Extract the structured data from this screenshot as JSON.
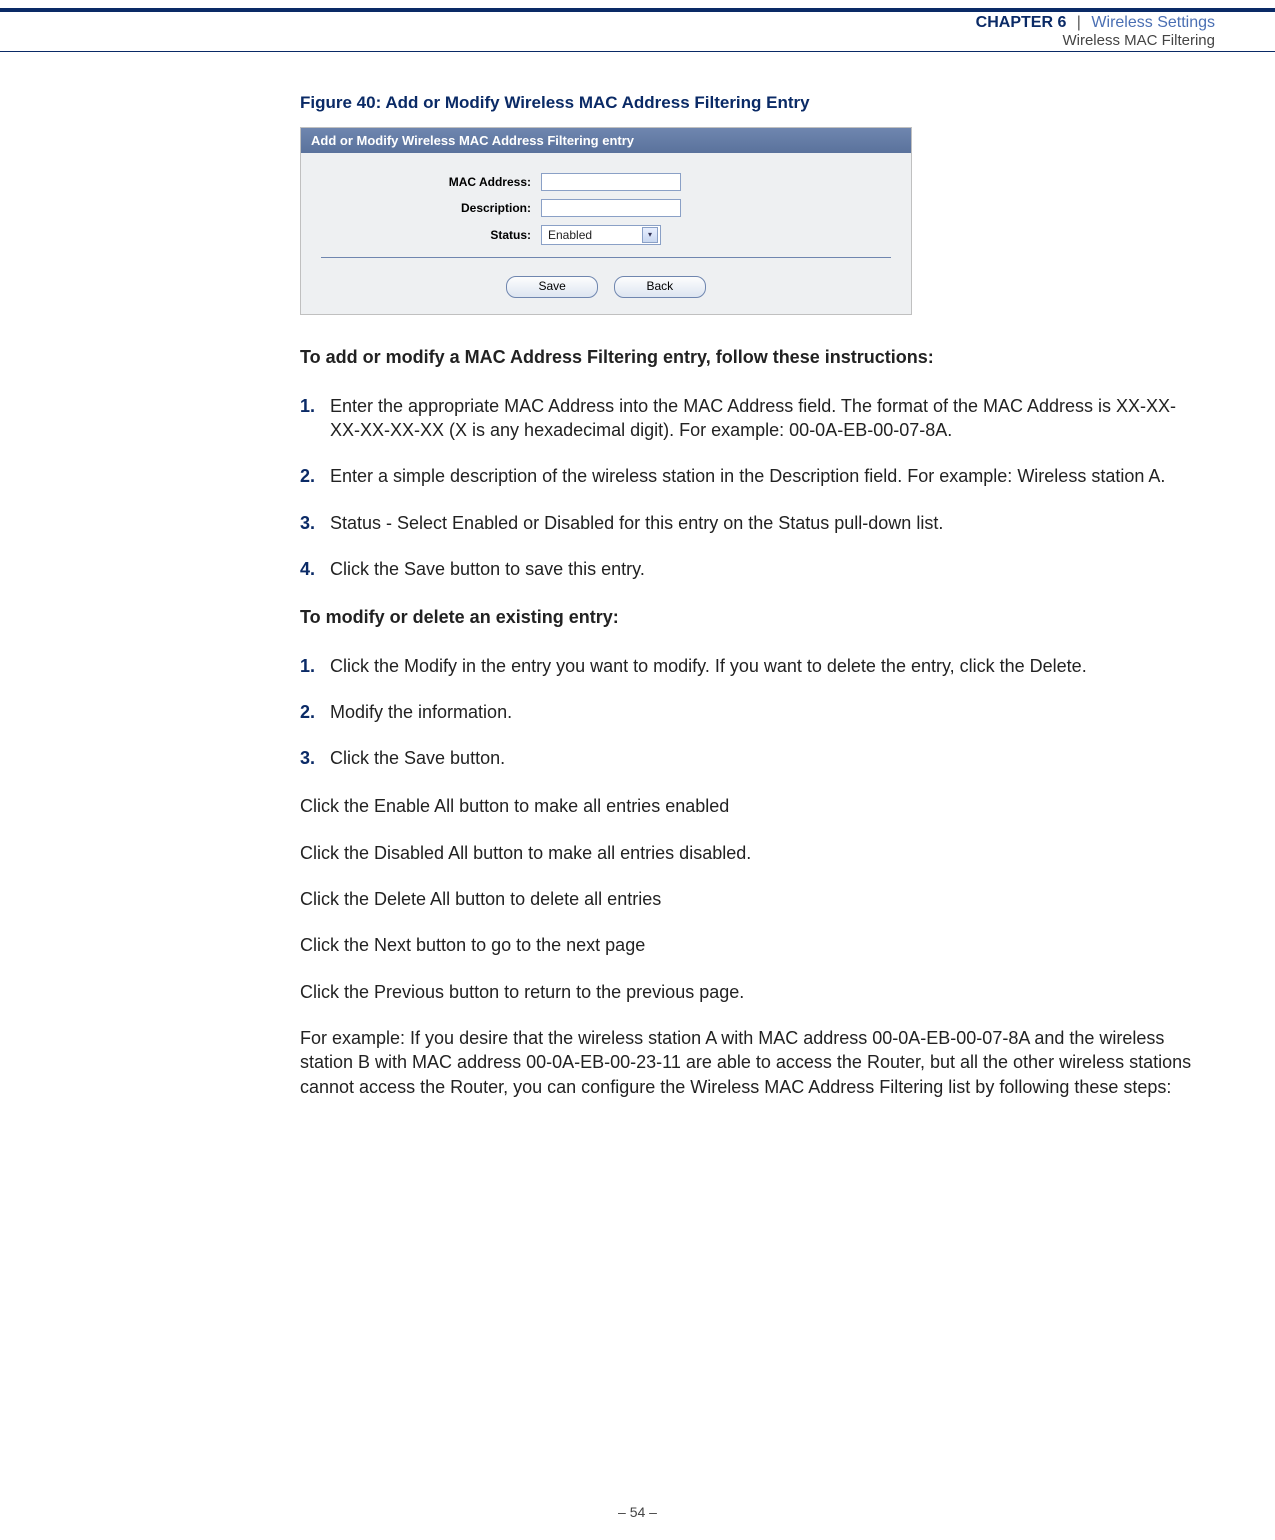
{
  "header": {
    "chapter": "CHAPTER 6",
    "separator": "|",
    "section": "Wireless Settings",
    "subsection": "Wireless MAC Filtering"
  },
  "figure": {
    "caption": "Figure 40:  Add or Modify Wireless MAC Address Filtering Entry",
    "titlebar": "Add or Modify Wireless MAC Address Filtering entry",
    "labels": {
      "mac": "MAC Address:",
      "description": "Description:",
      "status": "Status:"
    },
    "status_value": "Enabled",
    "buttons": {
      "save": "Save",
      "back": "Back"
    }
  },
  "instr1_title": "To add or modify a MAC Address Filtering entry, follow these instructions:",
  "list1": {
    "n1": "1.",
    "t1": "Enter the appropriate MAC Address into the MAC Address field. The format of the MAC Address is XX-XX-XX-XX-XX-XX (X is any hexadecimal digit). For example: 00-0A-EB-00-07-8A.",
    "n2": "2.",
    "t2": "Enter a simple description of the wireless station in the Description field. For example: Wireless station A.",
    "n3": "3.",
    "t3": "Status - Select Enabled or Disabled for this entry on the Status pull-down list.",
    "n4": "4.",
    "t4": "Click the Save button to save this entry."
  },
  "instr2_title": "To modify or delete an existing entry:",
  "list2": {
    "n1": "1.",
    "t1": "Click the Modify in the entry you want to modify. If you want to delete the entry, click the Delete.",
    "n2": "2.",
    "t2": "Modify the information.",
    "n3": "3.",
    "t3": "Click the Save button."
  },
  "paras": {
    "p1": "Click the Enable All button to make all entries enabled",
    "p2": "Click the Disabled All button to make all entries disabled.",
    "p3": "Click the Delete All button to delete all entries",
    "p4": "Click the Next button to go to the next page",
    "p5": "Click the Previous button to return to the previous page.",
    "p6": "For example: If you desire that the wireless station A with MAC address 00-0A-EB-00-07-8A and the wireless station B with MAC address 00-0A-EB-00-23-11 are able to access the Router, but all the other wireless stations cannot access the Router, you can configure the Wireless MAC Address Filtering list by following these steps:"
  },
  "footer": {
    "page": "–  54  –"
  }
}
